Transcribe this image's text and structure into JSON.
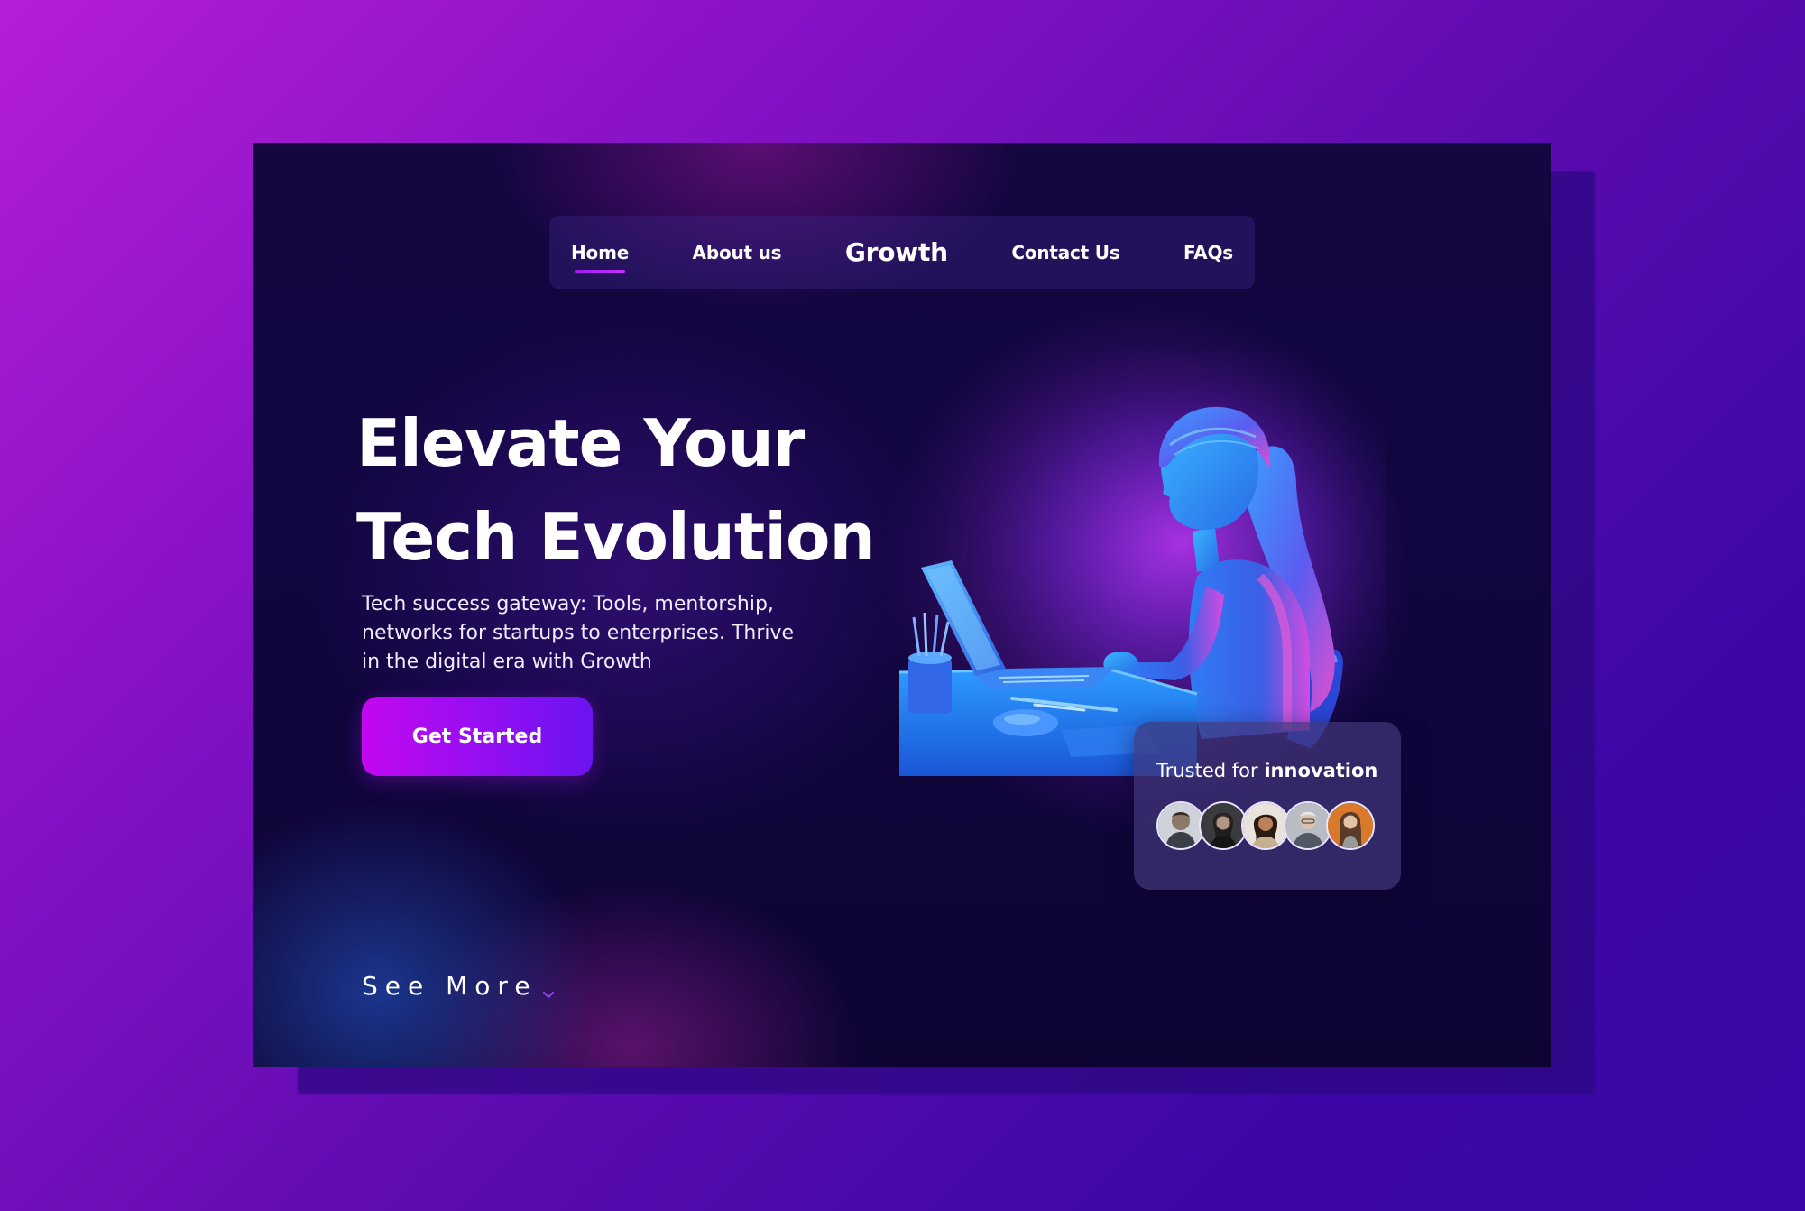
{
  "nav": {
    "items": [
      {
        "label": "Home",
        "active": true
      },
      {
        "label": "About us"
      },
      {
        "label": "Growth",
        "brand": true
      },
      {
        "label": "Contact Us"
      },
      {
        "label": "FAQs"
      }
    ]
  },
  "hero": {
    "title_line1": "Elevate Your",
    "title_line2": "Tech Evolution",
    "subtitle": "Tech success gateway: Tools, mentorship, networks for startups to enterprises. Thrive in the digital era with Growth",
    "cta_label": "Get Started",
    "see_more_label": "See More",
    "illustration": "woman-working-on-laptop-illustration"
  },
  "trusted": {
    "text_prefix": "Trusted for",
    "text_emphasis": "innovation",
    "avatar_count": 5
  },
  "colors": {
    "background_gradient_start": "#b51ed6",
    "background_gradient_end": "#3a08a8",
    "card_background": "#110640",
    "accent": "#c208f0",
    "accent_secondary": "#6a14f0"
  }
}
